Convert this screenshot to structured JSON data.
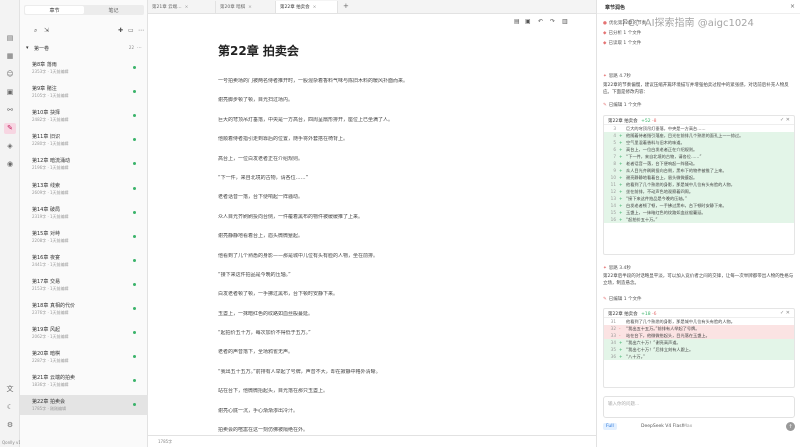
{
  "rail": {
    "icons": [
      "book-icon",
      "layout-icon",
      "user-icon",
      "map-icon",
      "relation-icon",
      "note-icon",
      "tag-icon",
      "globe-icon"
    ],
    "bottom_icons": [
      "translate-icon",
      "theme-icon",
      "settings-icon"
    ],
    "version": "Qonlly v1.3.3"
  },
  "chapters": {
    "tabs": [
      "章节",
      "笔记"
    ],
    "volume": {
      "title": "第一卷",
      "count": "22"
    },
    "items": [
      {
        "title": "第8章 落雨",
        "meta": "2353字 · 1天前编辑"
      },
      {
        "title": "第9章 赌注",
        "meta": "2105字 · 1天前编辑"
      },
      {
        "title": "第10章 抉择",
        "meta": "2482字 · 1天前编辑"
      },
      {
        "title": "第11章 旧识",
        "meta": "2280字 · 1天前编辑"
      },
      {
        "title": "第12章 暗流涌动",
        "meta": "2196字 · 1天前编辑"
      },
      {
        "title": "第13章 线索",
        "meta": "2609字 · 1天前编辑"
      },
      {
        "title": "第14章 破局",
        "meta": "2319字 · 1天前编辑"
      },
      {
        "title": "第15章 对峙",
        "meta": "2208字 · 1天前编辑"
      },
      {
        "title": "第16章 夜宴",
        "meta": "2441字 · 1天前编辑"
      },
      {
        "title": "第17章 交易",
        "meta": "2153字 · 1天前编辑"
      },
      {
        "title": "第18章 真相的代价",
        "meta": "2376字 · 1天前编辑"
      },
      {
        "title": "第19章 风起",
        "meta": "2062字 · 1天前编辑"
      },
      {
        "title": "第20章 暗棋",
        "meta": "2287字 · 1天前编辑"
      },
      {
        "title": "第21章 云端的拍卖",
        "meta": "1836字 · 1天前编辑"
      },
      {
        "title": "第22章 拍卖会",
        "meta": "1785字 · 刚刚编辑"
      }
    ]
  },
  "editor": {
    "tabs": [
      "第21章 云端…",
      "第20章 暗棋",
      "第22章 拍卖会"
    ],
    "title": "第22章 拍卖会",
    "paragraphs": [
      "一号拍卖场的门被两名侍者推开时，一股混杂着香料气味与陈旧木料的暖风扑面而来。",
      "谢亮脚步顿了顿，目光扫过场内。",
      "巨大的穹顶吊灯垂落，中央是一方高台，四周呈扇形排开，座位上已坐满了人。",
      "他顺着侍者指引走到靠后的位置，随手将外套搭在椅背上。",
      "高台上，一位白发老者正在介绍规则。",
      "“下一件，来自北境的古物，请各位……”",
      "老者话音一落，台下便响起一阵骚动。",
      "众人目光齐刷刷投向台侧，一件覆着黑布的物件被缓缓推了上来。",
      "谢亮静静地看着台上，眉头微微蹙起。",
      "他看到了几个熟悉的身影——那是城中几位有头有脸的人物，坐在前排。",
      "“接下来这件拍品是今晚的压轴。”",
      "白发老者顿了顿，一手拂过黑布，台下顿时安静下来。",
      "玉盏上，一抹暗红色的纹路如血丝般蔓延。",
      "“起拍价五十万，每次加价不得低于五万。”",
      "老者的声音落下，全场鸦雀无声。",
      "“我出五十五万。”前排有人举起了号牌，声音不大，却在寂静中格外清晰。",
      "站在台下，他微微抬起头，目光落在那只玉盏上。",
      "谢亮心底一沉，手心渐渐渗出冷汗。",
      "拍卖会的喧嚣在这一刻仿佛被隔绝在外。"
    ],
    "word_count": "1785字"
  },
  "ai": {
    "title": "章节润色",
    "user_msg": "优化第22章的节奏",
    "status1": "已分析 1 个文件",
    "status2": "已读取 1 个文件",
    "section1": "思路 4.7秒",
    "msg1": "第22章的节奏偏慢，建议压缩开篇环境描写并增强拍卖过程中的紧张感，对话前后补充人物反应。下面是修改内容：",
    "diff1": {
      "file": "第22章 拍卖会",
      "add": "+52",
      "del": "-8",
      "lines": [
        {
          "n": "3",
          "s": " ",
          "t": "巨大的穹顶吊灯垂落，中央是一方高台……"
        },
        {
          "n": "4",
          "s": "+",
          "t": "他随着侍者指引落座，目光在前排几个熟悉的面孔上一一掠过。"
        },
        {
          "n": "5",
          "s": "+",
          "t": "空气里混着香料与旧木的味道。"
        },
        {
          "n": "6",
          "s": "+",
          "t": "高台上，一位白发老者正在介绍规则。"
        },
        {
          "n": "7",
          "s": "+",
          "t": "“下一件，来自北境的古物，请各位……”"
        },
        {
          "n": "8",
          "s": "+",
          "t": "老者话音一落，台下便响起一阵骚动。"
        },
        {
          "n": "9",
          "s": "+",
          "t": "众人目光齐刷刷投向台侧，黑布下的物件被推了上来。"
        },
        {
          "n": "10",
          "s": "+",
          "t": "谢亮静静地看着台上，眉头微微蹙起。"
        },
        {
          "n": "11",
          "s": "+",
          "t": "他看到了几个熟悉的身影，那是城中几位有头有脸的人物，"
        },
        {
          "n": "12",
          "s": "+",
          "t": "坐在前排，不动声色地观察着四周。"
        },
        {
          "n": "13",
          "s": "+",
          "t": "“接下来这件拍品是今晚的压轴。”"
        },
        {
          "n": "14",
          "s": "+",
          "t": "白发老者顿了顿，一手拂过黑布，台下顿时安静下来。"
        },
        {
          "n": "15",
          "s": "+",
          "t": "玉盏上，一抹暗红色的纹路如血丝般蔓延。"
        },
        {
          "n": "16",
          "s": "+",
          "t": "“起拍价五十万。”"
        }
      ]
    },
    "section2": "思路 3.4秒",
    "msg2": "第22章后半段的对话略显平淡，可以加入竞价者之间的交锋，让每一次举牌都带出人物的性格与立场，制造悬念。",
    "status3": "已编辑 1 个文件",
    "diff2": {
      "file": "第22章 拍卖会",
      "add": "+18",
      "del": "-6",
      "lines": [
        {
          "n": "31",
          "s": " ",
          "t": "他看到了几个熟悉的身影，那是城中几位有头有脸的人物。"
        },
        {
          "n": "32",
          "s": "-",
          "t": "“我出五十五万。”前排有人举起了号牌。"
        },
        {
          "n": "33",
          "s": "-",
          "t": "站在台下，他微微抬起头，目光落在玉盏上。"
        },
        {
          "n": "34",
          "s": "+",
          "t": "“我出六十万！”谢亮高声道。"
        },
        {
          "n": "35",
          "s": "+",
          "t": "“我出七十万！”后排立刻有人跟上。"
        },
        {
          "n": "36",
          "s": "+",
          "t": "“八十万。”"
        }
      ]
    },
    "placeholder": "输入你的问题...",
    "mode": "Full",
    "model": "DeepSeek V4 Flash",
    "tag": "Max"
  },
  "watermark": "FC：AI探索指南 @aigc1024",
  "colors": {
    "accent": "#c2185b",
    "added": "#3ab36a",
    "removed": "#e57373",
    "mode": "#1e6fd9"
  }
}
